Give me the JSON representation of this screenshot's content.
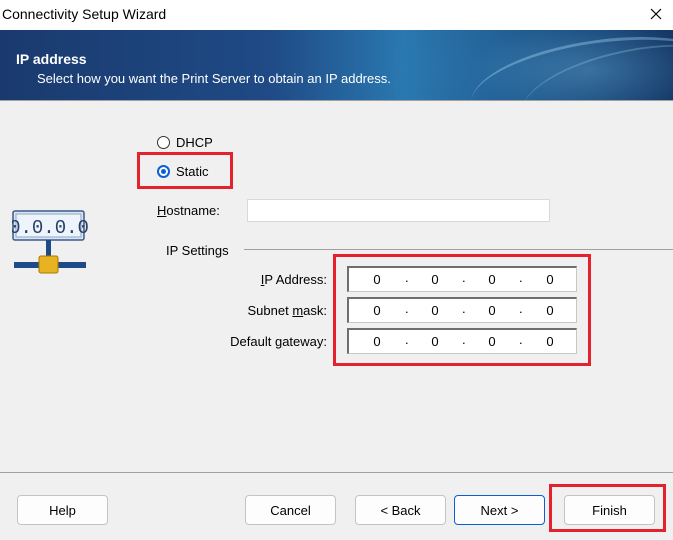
{
  "window": {
    "title": "Connectivity Setup Wizard",
    "close_icon": "close-icon"
  },
  "banner": {
    "title": "IP address",
    "subtitle": "Select how you want the Print Server to obtain an IP address."
  },
  "mode": {
    "options": [
      {
        "label": "DHCP",
        "selected": false
      },
      {
        "label": "Static",
        "selected": true
      }
    ]
  },
  "icon": {
    "display": "0.0.0.0",
    "name": "network-ip-icon"
  },
  "hostname": {
    "label_underlined": "H",
    "label_rest": "ostname:",
    "value": ""
  },
  "ip_settings": {
    "group_label": "IP Settings",
    "fields": [
      {
        "label_pre": "",
        "label_u": "I",
        "label_post": "P Address:",
        "octets": [
          "0",
          "0",
          "0",
          "0"
        ]
      },
      {
        "label_pre": "Subnet ",
        "label_u": "m",
        "label_post": "ask:",
        "octets": [
          "0",
          "0",
          "0",
          "0"
        ]
      },
      {
        "label_pre": "Default ",
        "label_u": "g",
        "label_post": "ateway:",
        "octets": [
          "0",
          "0",
          "0",
          "0"
        ]
      }
    ]
  },
  "buttons": {
    "help": "Help",
    "cancel": "Cancel",
    "back": "< Back",
    "next": "Next >",
    "finish": "Finish"
  },
  "colors": {
    "highlight": "#e3222e",
    "accent": "#0a5fd6"
  }
}
